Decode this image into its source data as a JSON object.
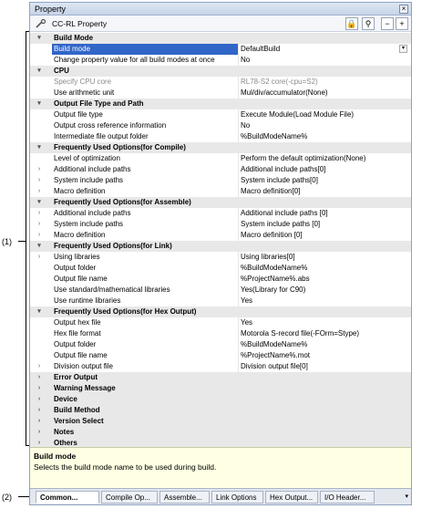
{
  "callouts": {
    "one": "(1)",
    "two": "(2)"
  },
  "window": {
    "title": "Property",
    "close_glyph": "×"
  },
  "toolbar": {
    "title": "CC-RL Property",
    "buttons": [
      "🔒",
      "⚲",
      "−",
      "+"
    ]
  },
  "rows": [
    {
      "kind": "cat",
      "toggle": "▾",
      "name": "Build Mode"
    },
    {
      "kind": "prop",
      "name": "Build mode",
      "value": "DefaultBuild",
      "selected": true,
      "dropdown": true
    },
    {
      "kind": "prop",
      "name": "Change property value for all build modes at once",
      "value": "No"
    },
    {
      "kind": "cat",
      "toggle": "▾",
      "name": "CPU"
    },
    {
      "kind": "prop",
      "name": "Specify CPU core",
      "value": "RL78-S2 core(-cpu=S2)",
      "disabled": true
    },
    {
      "kind": "prop",
      "name": "Use arithmetic unit",
      "value": "Mul/div/accumulator(None)"
    },
    {
      "kind": "cat",
      "toggle": "▾",
      "name": "Output File Type and Path"
    },
    {
      "kind": "prop",
      "name": "Output file type",
      "value": "Execute Module(Load Module File)"
    },
    {
      "kind": "prop",
      "name": "Output cross reference information",
      "value": "No"
    },
    {
      "kind": "prop",
      "name": "Intermediate file output folder",
      "value": "%BuildModeName%"
    },
    {
      "kind": "cat",
      "toggle": "▾",
      "name": "Frequently Used Options(for Compile)"
    },
    {
      "kind": "prop",
      "name": "Level of optimization",
      "value": "Perform the default optimization(None)"
    },
    {
      "kind": "prop",
      "toggle": "›",
      "name": "Additional include paths",
      "value": "Additional include paths[0]"
    },
    {
      "kind": "prop",
      "toggle": "›",
      "name": "System include paths",
      "value": "System include paths[0]"
    },
    {
      "kind": "prop",
      "toggle": "›",
      "name": "Macro definition",
      "value": "Macro definition[0]"
    },
    {
      "kind": "cat",
      "toggle": "▾",
      "name": "Frequently Used Options(for Assemble)"
    },
    {
      "kind": "prop",
      "toggle": "›",
      "name": "Additional include paths",
      "value": "Additional include paths [0]"
    },
    {
      "kind": "prop",
      "toggle": "›",
      "name": "System include paths",
      "value": "System include paths [0]"
    },
    {
      "kind": "prop",
      "toggle": "›",
      "name": "Macro definition",
      "value": "Macro definition [0]"
    },
    {
      "kind": "cat",
      "toggle": "▾",
      "name": "Frequently Used Options(for Link)"
    },
    {
      "kind": "prop",
      "toggle": "›",
      "name": "Using libraries",
      "value": "Using libraries[0]"
    },
    {
      "kind": "prop",
      "name": "Output folder",
      "value": "%BuildModeName%"
    },
    {
      "kind": "prop",
      "name": "Output file name",
      "value": "%ProjectName%.abs"
    },
    {
      "kind": "prop",
      "name": "Use standard/mathematical libraries",
      "value": "Yes(Library for C90)"
    },
    {
      "kind": "prop",
      "name": "Use runtime libraries",
      "value": "Yes"
    },
    {
      "kind": "cat",
      "toggle": "▾",
      "name": "Frequently Used Options(for Hex Output)"
    },
    {
      "kind": "prop",
      "name": "Output hex file",
      "value": "Yes"
    },
    {
      "kind": "prop",
      "name": "Hex file format",
      "value": "Motorola S-record file(-FOrm=Stype)"
    },
    {
      "kind": "prop",
      "name": "Output folder",
      "value": "%BuildModeName%"
    },
    {
      "kind": "prop",
      "name": "Output file name",
      "value": "%ProjectName%.mot"
    },
    {
      "kind": "prop",
      "toggle": "›",
      "name": "Division output file",
      "value": "Division output file[0]"
    },
    {
      "kind": "cat",
      "toggle": "›",
      "name": "Error Output"
    },
    {
      "kind": "cat",
      "toggle": "›",
      "name": "Warning Message"
    },
    {
      "kind": "cat",
      "toggle": "›",
      "name": "Device"
    },
    {
      "kind": "cat",
      "toggle": "›",
      "name": "Build Method"
    },
    {
      "kind": "cat",
      "toggle": "›",
      "name": "Version Select"
    },
    {
      "kind": "cat",
      "toggle": "›",
      "name": "Notes"
    },
    {
      "kind": "cat",
      "toggle": "›",
      "name": "Others"
    }
  ],
  "description": {
    "title": "Build mode",
    "text": "Selects the build mode name to be used during build."
  },
  "tabs": [
    "Common...",
    "Compile Op...",
    "Assemble...",
    "Link Options",
    "Hex Output...",
    "I/O Header..."
  ],
  "tab_menu_glyph": "▾"
}
